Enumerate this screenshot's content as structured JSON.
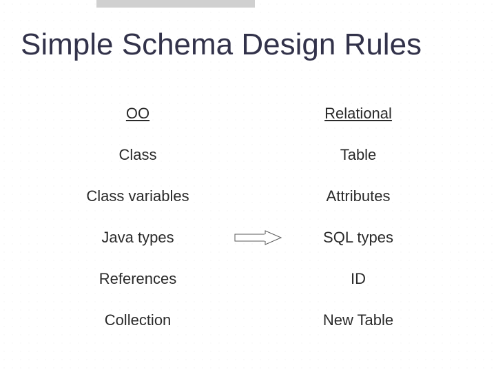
{
  "title": "Simple Schema Design Rules",
  "columns": {
    "left": "OO",
    "right": "Relational"
  },
  "rows": [
    {
      "left": "Class",
      "right": "Table",
      "arrow": false
    },
    {
      "left": "Class variables",
      "right": "Attributes",
      "arrow": false
    },
    {
      "left": "Java types",
      "right": "SQL types",
      "arrow": true
    },
    {
      "left": "References",
      "right": "ID",
      "arrow": false
    },
    {
      "left": "Collection",
      "right": "New Table",
      "arrow": false
    }
  ],
  "chart_data": {
    "type": "table",
    "title": "Simple Schema Design Rules",
    "columns": [
      "OO",
      "Relational"
    ],
    "rows": [
      [
        "Class",
        "Table"
      ],
      [
        "Class variables",
        "Attributes"
      ],
      [
        "Java types",
        "SQL types"
      ],
      [
        "References",
        "ID"
      ],
      [
        "Collection",
        "New Table"
      ]
    ]
  }
}
